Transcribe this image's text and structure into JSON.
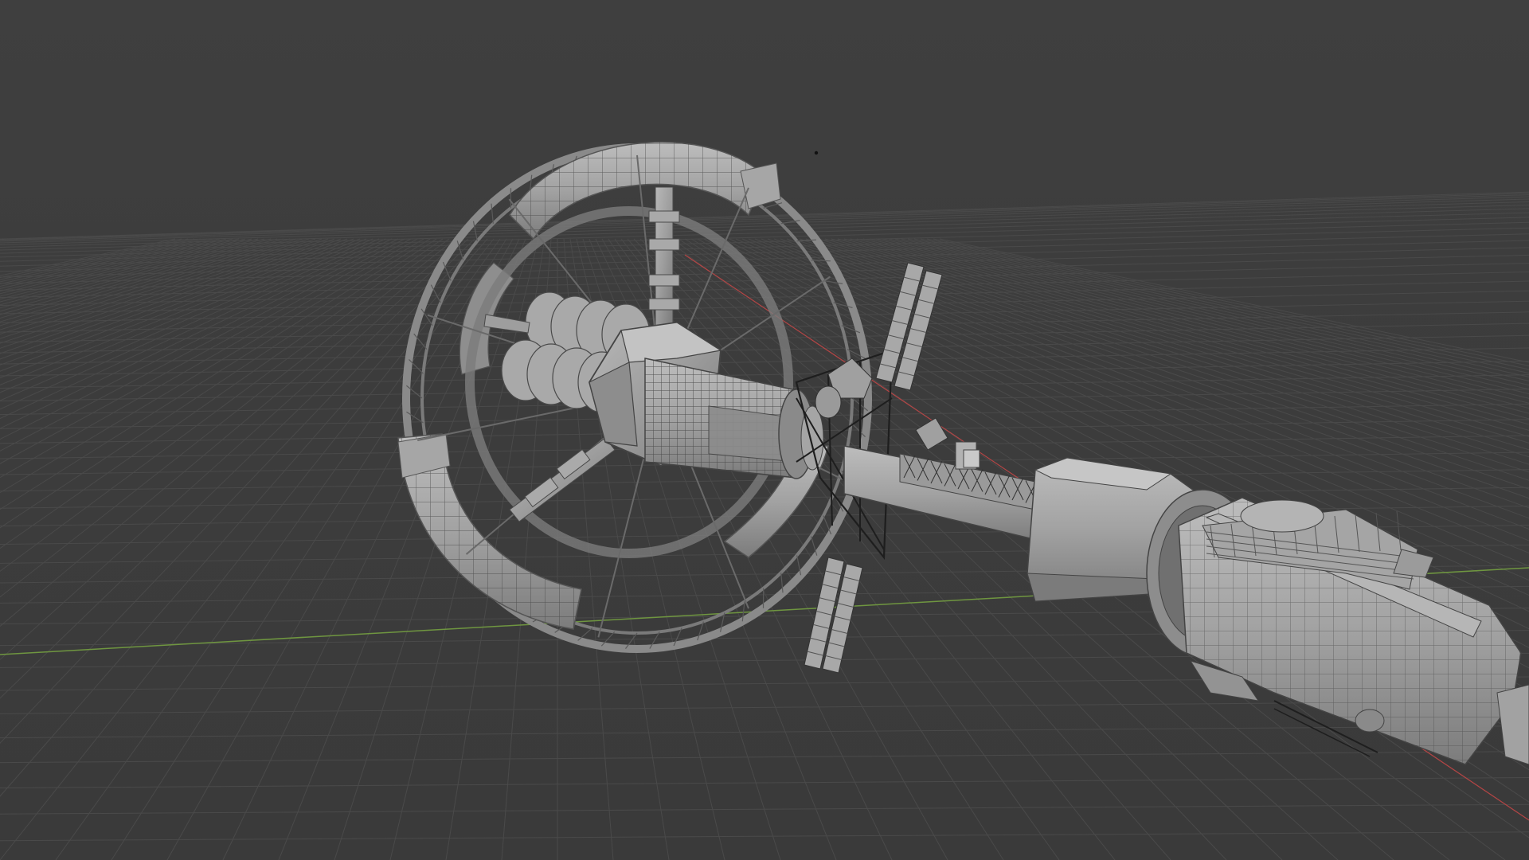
{
  "scene": {
    "background_color": "#3d3d3d",
    "grid_color": "#4a4a4a",
    "x_axis_color": "#b44545",
    "y_axis_color": "#6f9640",
    "mesh_fill": "#9c9c9c",
    "mesh_light": "#b9b9b9",
    "mesh_shadow": "#6e6e6e",
    "wire_color": "#2f2f2f",
    "objects": [
      "station-ring-outer",
      "station-ring-inner",
      "ring-spokes",
      "hex-hub",
      "engine-tanks",
      "central-truss",
      "solar-panels",
      "docking-module",
      "rear-module"
    ]
  }
}
